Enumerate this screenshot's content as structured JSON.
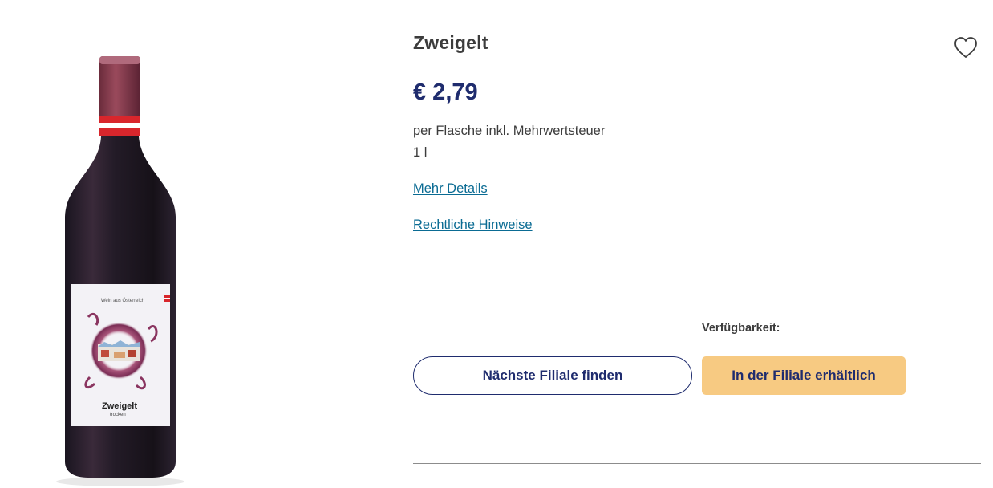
{
  "product": {
    "title": "Zweigelt",
    "price": "€ 2,79",
    "price_note": "per Flasche inkl. Mehrwertsteuer",
    "size": "1 l",
    "image": {
      "alt": "Zweigelt Rotweinflasche",
      "label_origin": "Wein aus Österreich",
      "label_name": "Zweigelt",
      "label_sub": "trocken"
    }
  },
  "links": {
    "details": "Mehr Details",
    "legal": "Rechtliche Hinweise"
  },
  "availability": {
    "label": "Verfügbarkeit:",
    "find_store_button": "Nächste Filiale finden",
    "in_store_button": "In der Filiale erhältlich"
  },
  "colors": {
    "brand_navy": "#1f2c6e",
    "link_blue": "#0a6b93",
    "accent_yellow": "#f7ca82"
  },
  "icons": {
    "wishlist": "heart-outline-icon"
  }
}
